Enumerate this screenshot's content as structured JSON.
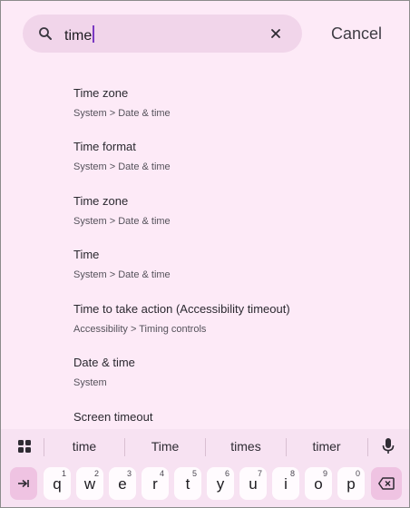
{
  "search": {
    "query": "time",
    "cancel_label": "Cancel"
  },
  "results": [
    {
      "title": "Time zone",
      "path": "System > Date & time"
    },
    {
      "title": "Time format",
      "path": "System > Date & time"
    },
    {
      "title": "Time zone",
      "path": "System > Date & time"
    },
    {
      "title": "Time",
      "path": "System > Date & time"
    },
    {
      "title": "Time to take action (Accessibility timeout)",
      "path": "Accessibility > Timing controls"
    },
    {
      "title": "Date & time",
      "path": "System"
    },
    {
      "title": "Screen timeout",
      "path": ""
    }
  ],
  "keyboard": {
    "suggestions": [
      "time",
      "Time",
      "times",
      "timer"
    ],
    "keys": [
      {
        "letter": "q",
        "num": "1"
      },
      {
        "letter": "w",
        "num": "2"
      },
      {
        "letter": "e",
        "num": "3"
      },
      {
        "letter": "r",
        "num": "4"
      },
      {
        "letter": "t",
        "num": "5"
      },
      {
        "letter": "y",
        "num": "6"
      },
      {
        "letter": "u",
        "num": "7"
      },
      {
        "letter": "i",
        "num": "8"
      },
      {
        "letter": "o",
        "num": "9"
      },
      {
        "letter": "p",
        "num": "0"
      }
    ],
    "icons": {
      "left": "tab-icon",
      "right": "backspace-icon",
      "tools": "apps-grid-icon",
      "voice": "mic-icon"
    }
  },
  "colors": {
    "background": "#fdeaf7",
    "search_bar": "#f1d5ea",
    "caret": "#7a3ac2",
    "keyboard": "#f7e2f2",
    "special_key": "#efc3e2"
  }
}
